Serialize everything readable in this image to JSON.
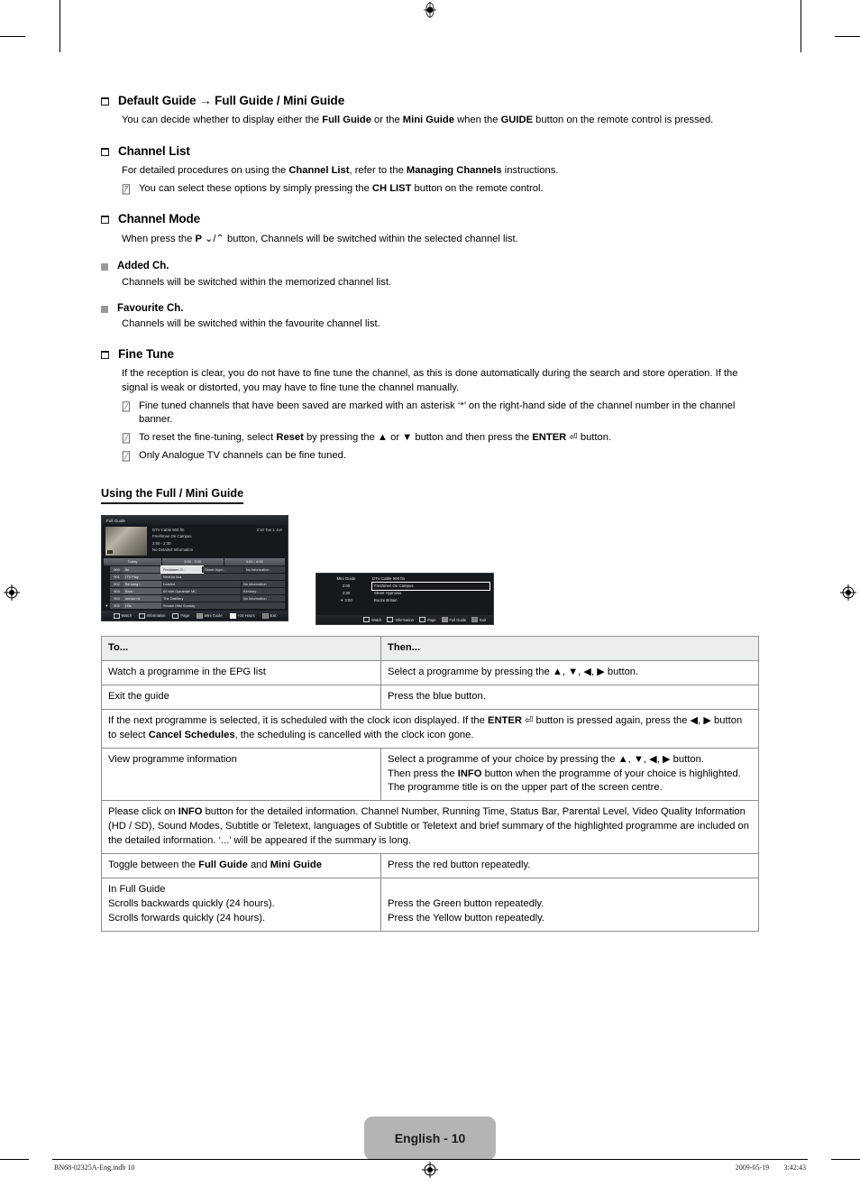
{
  "document": {
    "page_label": "English - 10",
    "footer_left": "BN68-02325A-Eng.indb   10",
    "footer_right": "2009-05-19    3:42:43"
  },
  "sections": [
    {
      "id": "default-guide",
      "heading": "Default Guide → Full Guide / Mini Guide",
      "body_html": "You can decide whether to display either the <b>Full Guide</b> or the <b>Mini Guide</b> when the <b>GUIDE</b> button on the remote control is pressed."
    },
    {
      "id": "channel-list",
      "heading": "Channel List",
      "body_html": "For detailed procedures on using the <b>Channel List</b>, refer to the <b>Managing Channels</b> instructions.",
      "note_html": "You can select these options by simply pressing the <b>CH LIST</b> button on the remote control."
    },
    {
      "id": "channel-mode",
      "heading": "Channel Mode",
      "body_html": "When press the <b>P</b> <span class=\"sym\">⌄</span>/<span class=\"sym\">⌃</span> button, Channels will be switched within the selected channel list.",
      "sub": [
        {
          "heading": "Added Ch.",
          "body_html": "Channels will be switched within the memorized channel list."
        },
        {
          "heading": "Favourite Ch.",
          "body_html": "Channels will be switched within the favourite channel list."
        }
      ]
    },
    {
      "id": "fine-tune",
      "heading": "Fine Tune",
      "body_html": "If the reception is clear, you do not have to fine tune the channel, as this is done automatically during the search and store operation. If the signal is weak or distorted, you may have to fine tune the channel manually.",
      "notes_html": [
        "Fine tuned channels that have been saved are marked with an asterisk ‘*’ on the right-hand side of the channel number in the channel banner.",
        "To reset the fine-tuning, select <b>Reset</b> by pressing the ▲ or ▼ button and then press the <b>ENTER</b> <span class=\"enter-key\">⏎</span> button.",
        "Only Analogue TV channels can be fine tuned."
      ]
    }
  ],
  "guide_section": {
    "title": "Using the Full / Mini Guide"
  },
  "full_guide": {
    "title": "Full Guide",
    "channel": "DTV Cable 900 ftn",
    "clock": "2:10 Tue 1 Jun",
    "programme": "Freshmen On Campus",
    "time_range": "2:00 - 2:30",
    "detail": "No Detailed Information",
    "timebar": [
      "Today",
      "2:00 - 3:00",
      "3:00 - 4:00"
    ],
    "rows": [
      {
        "arrow": "",
        "num": "900",
        "name": "ftn",
        "cells": [
          {
            "text": "Freshmen O..",
            "selected": true,
            "span": "f1"
          },
          {
            "text": "Street Hypn..",
            "selected": false,
            "span": "f2"
          },
          {
            "text": "No Information",
            "selected": false,
            "span": "grow"
          }
        ]
      },
      {
        "arrow": "",
        "num": "901",
        "name": "ITV Play",
        "cells": [
          {
            "text": "Nind ku ksa",
            "selected": false,
            "span": "grow"
          }
        ]
      },
      {
        "arrow": "",
        "num": "902",
        "name": "Be sang !",
        "cells": [
          {
            "text": "Loaded",
            "selected": false,
            "span": "f3"
          },
          {
            "text": "No Information",
            "selected": false,
            "span": "grow"
          }
        ]
      },
      {
        "arrow": "",
        "num": "903",
        "name": "Bros",
        "cells": [
          {
            "text": "60 with Dynamite MC",
            "selected": false,
            "span": "f3"
          },
          {
            "text": "Kimbory",
            "selected": false,
            "span": "grow"
          }
        ]
      },
      {
        "arrow": "",
        "num": "904",
        "name": "unnwo rd",
        "cells": [
          {
            "text": "The Distillery",
            "selected": false,
            "span": "f3"
          },
          {
            "text": "No Information",
            "selected": false,
            "span": "grow"
          }
        ]
      },
      {
        "arrow": "▼",
        "num": "905",
        "name": "H3s",
        "cells": [
          {
            "text": "Smash Hits! Sunday",
            "selected": false,
            "span": "grow"
          }
        ]
      }
    ],
    "footer": [
      {
        "key": "enter",
        "label": "Watch"
      },
      {
        "key": "info",
        "label": "Information"
      },
      {
        "key": "page",
        "label": "Page"
      },
      {
        "key": "red",
        "label": "Mini Guide"
      },
      {
        "key": "yellow",
        "label": "+24 Hours"
      },
      {
        "key": "blue",
        "label": "Exit"
      }
    ]
  },
  "mini_guide": {
    "title": "Mini Guide",
    "channel": "DTV Cable 900 ftn",
    "rows": [
      {
        "time": "2:00",
        "programme": "Freshmen On Campus",
        "selected": true,
        "arrow": ""
      },
      {
        "time": "2:30",
        "programme": "Street Hypnosis",
        "selected": false,
        "arrow": ""
      },
      {
        "time": "3:00",
        "programme": "Booze Britain",
        "selected": false,
        "arrow": "▼"
      }
    ],
    "footer": [
      {
        "key": "enter",
        "label": "Watch"
      },
      {
        "key": "info",
        "label": "Information"
      },
      {
        "key": "page",
        "label": "Page"
      },
      {
        "key": "red",
        "label": "Full Guide"
      },
      {
        "key": "blue",
        "label": "Exit"
      }
    ]
  },
  "table": {
    "headers": [
      "To...",
      "Then..."
    ],
    "rows": [
      {
        "type": "pair",
        "to_html": "Watch a programme in the EPG list",
        "then_html": "Select a programme by pressing the ▲, ▼, ◀, ▶ button."
      },
      {
        "type": "pair",
        "to_html": "Exit the guide",
        "then_html": "Press the blue button."
      },
      {
        "type": "full",
        "text_html": "If the next programme is selected, it is scheduled with the clock icon displayed. If the <b>ENTER</b> <span class=\"enter-key\">⏎</span> button is pressed again, press the ◀, ▶ button to select <b>Cancel Schedules</b>, the scheduling is cancelled with the clock icon gone."
      },
      {
        "type": "pair",
        "to_html": "View programme information",
        "then_html": "Select a programme of your choice by pressing the ▲, ▼, ◀, ▶ button.<br>Then press the <b>INFO</b> button when the programme of your choice is highlighted.<br>The programme title is on the upper part of the screen centre."
      },
      {
        "type": "full",
        "text_html": "Please click on <b>INFO</b> button for the detailed information. Channel Number, Running Time, Status Bar, Parental Level, Video Quality Information (HD / SD), Sound Modes, Subtitle or Teletext, languages of Subtitle or Teletext and brief summary of the highlighted programme are included on the detailed information. ‘...’ will be appeared if the summary is long."
      },
      {
        "type": "pair",
        "to_html": "Toggle between the <b>Full Guide</b> and <b>Mini Guide</b>",
        "then_html": "Press the red button repeatedly."
      },
      {
        "type": "pair",
        "to_html": "In Full Guide<br>Scrolls backwards quickly (24 hours).<br>Scrolls forwards quickly (24 hours).",
        "then_html": "<br>Press the Green button repeatedly.<br>Press the Yellow button repeatedly."
      }
    ]
  }
}
